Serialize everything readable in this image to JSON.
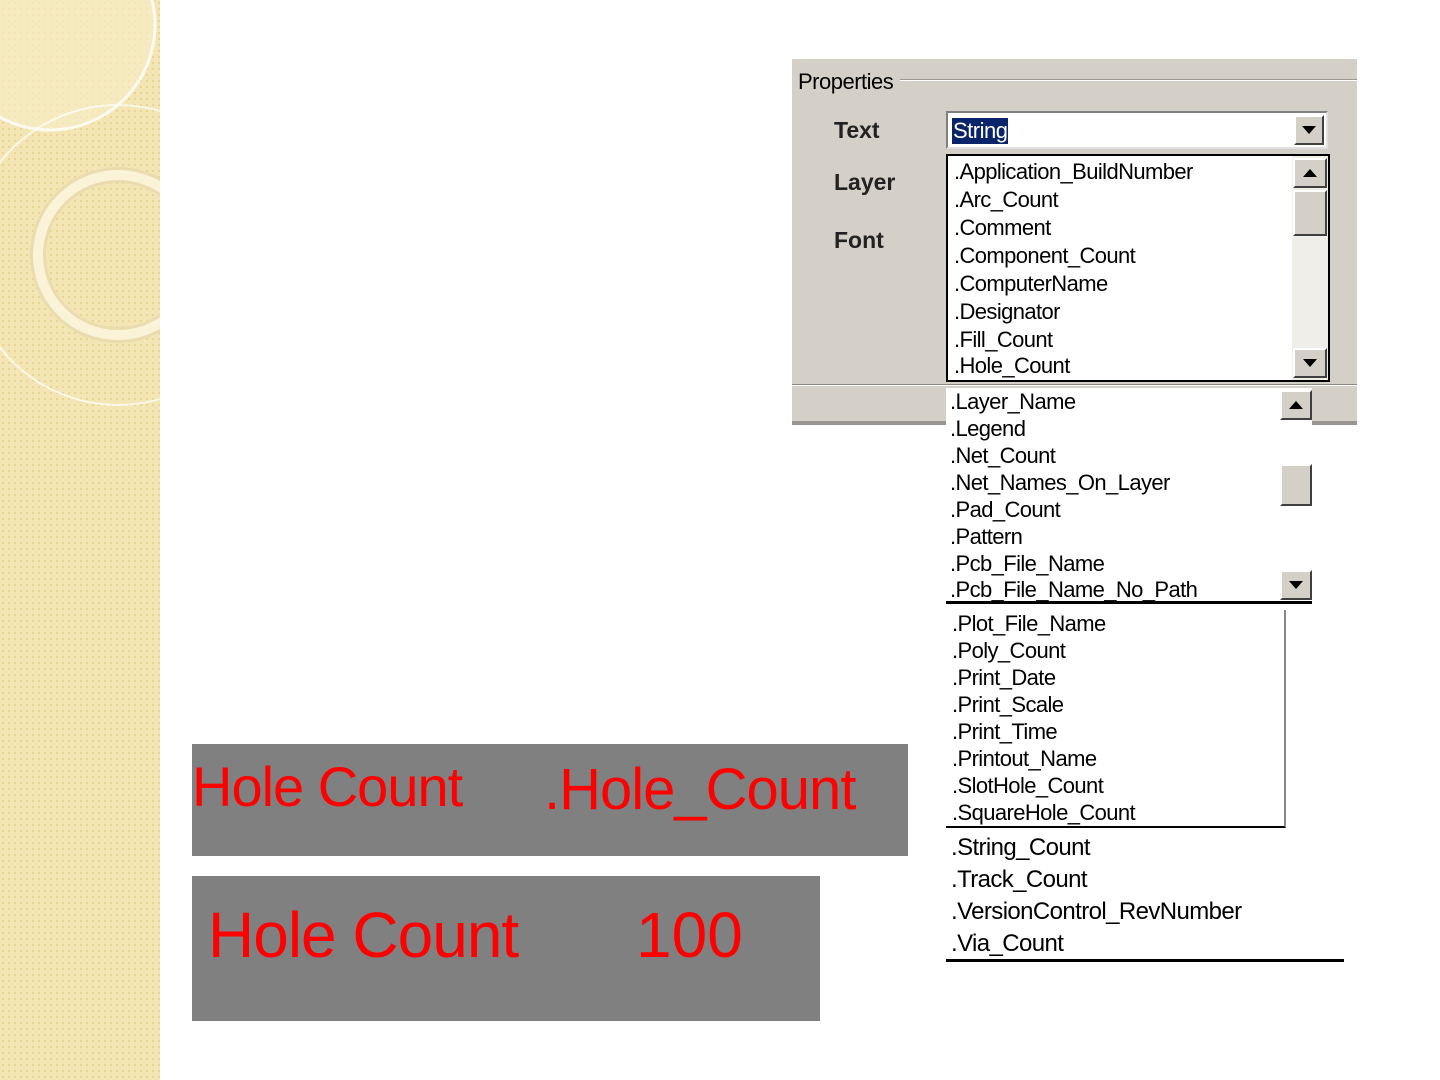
{
  "colors": {
    "sidebar": "#f4e6b4",
    "dialog": "#d4d0c8",
    "selection": "#0a246a",
    "preview_background": "#808080",
    "preview_text": "#ff0000"
  },
  "properties": {
    "legend": "Properties",
    "labels": {
      "text": "Text",
      "layer": "Layer",
      "font": "Font"
    },
    "text_combo_value": "String"
  },
  "lists": {
    "list1": [
      ".Application_BuildNumber",
      ".Arc_Count",
      ".Comment",
      ".Component_Count",
      ".ComputerName",
      ".Designator",
      ".Fill_Count",
      ".Hole_Count"
    ],
    "list2": [
      ".Layer_Name",
      ".Legend",
      ".Net_Count",
      ".Net_Names_On_Layer",
      ".Pad_Count",
      ".Pattern",
      ".Pcb_File_Name",
      ".Pcb_File_Name_No_Path"
    ],
    "list3": [
      ".Plot_File_Name",
      ".Poly_Count",
      ".Print_Date",
      ".Print_Scale",
      ".Print_Time",
      ".Printout_Name",
      ".SlotHole_Count",
      ".SquareHole_Count"
    ],
    "list4": [
      ".String_Count",
      ".Track_Count",
      ".VersionControl_RevNumber",
      ".Via_Count"
    ]
  },
  "previews": {
    "p1": {
      "label": "Hole Count",
      "value": ".Hole_Count"
    },
    "p2": {
      "label": "Hole Count",
      "value": "100"
    }
  }
}
